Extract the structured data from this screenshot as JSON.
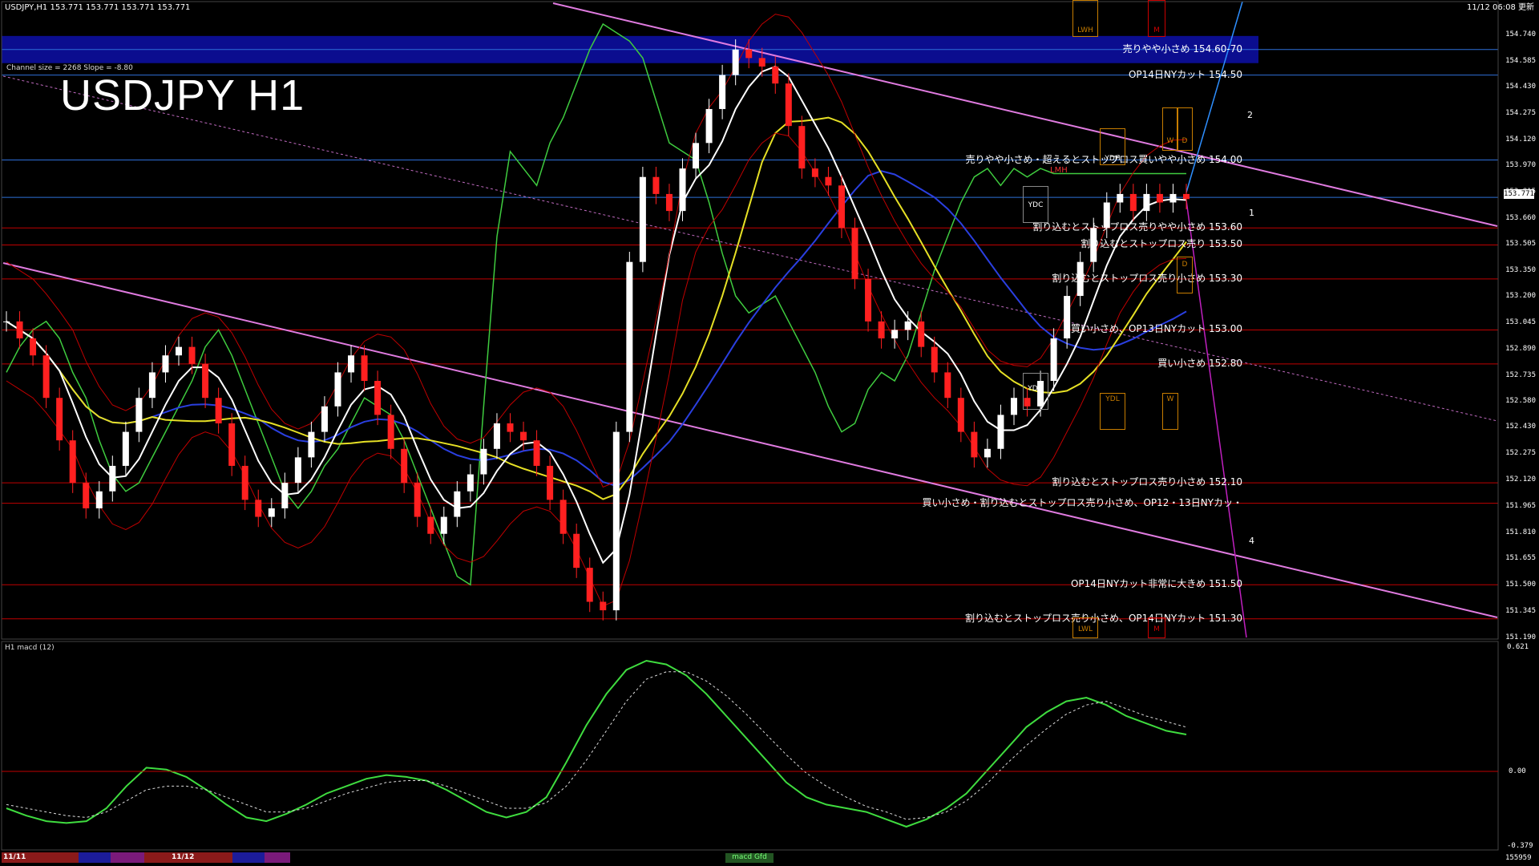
{
  "header": {
    "symbol_info": "USDJPY,H1  153.771 153.771 153.771 153.771",
    "datetime": "11/12 06:08 更新"
  },
  "chart_overlay": {
    "title": "USDJPY H1",
    "channel_info": "Channel size = 2268 Slope = -8.80",
    "current_price": "153.771",
    "channel_numbers": [
      "2",
      "1",
      "4"
    ]
  },
  "box_labels": {
    "lwh": "LWH",
    "m": "M",
    "ydh": "YDH",
    "w": "W",
    "d": "D",
    "lmh": "LMH",
    "ydc": "YDC",
    "ydo": "YDO",
    "ydl": "YDL",
    "w2": "W",
    "d2": "D",
    "lwl": "LWL",
    "lml": "LML"
  },
  "annotations": [
    {
      "text": "売りやや小さめ 154.60-70",
      "price": 154.65,
      "color": "#ffffff",
      "highlight": "#0b0d8f"
    },
    {
      "text": "OP14日NYカット 154.50",
      "price": 154.5,
      "color": "#ffffff"
    },
    {
      "text": "売りやや小さめ・超えるとストップロス買いやや小さめ 154.00",
      "price": 154.0,
      "color": "#ffffff"
    },
    {
      "text": "割り込むとストップロス売りやや小さめ 153.60",
      "price": 153.6,
      "color": "#ffffff"
    },
    {
      "text": "割り込むとストップロス売り 153.50",
      "price": 153.5,
      "color": "#ffffff"
    },
    {
      "text": "割り込むとストップロス売り小さめ 153.30",
      "price": 153.3,
      "color": "#ffffff"
    },
    {
      "text": "買い小さめ、OP13日NYカット 153.00",
      "price": 153.0,
      "color": "#ffffff"
    },
    {
      "text": "買い小さめ 152.80",
      "price": 152.8,
      "color": "#ffffff"
    },
    {
      "text": "割り込むとストップロス売り小さめ 152.10",
      "price": 152.1,
      "color": "#ffffff"
    },
    {
      "text": "買い小さめ・割り込むとストップロス売り小さめ、OP12・13日NYカッ・",
      "price": 151.98,
      "color": "#ffffff"
    },
    {
      "text": "OP14日NYカット非常に大きめ 151.50",
      "price": 151.5,
      "color": "#ffffff"
    },
    {
      "text": "割り込むとストップロス売り小さめ、OP14日NYカット 151.30",
      "price": 151.3,
      "color": "#ffffff"
    }
  ],
  "price_axis": {
    "ticks": [
      "154.740",
      "154.585",
      "154.430",
      "154.275",
      "154.120",
      "153.970",
      "153.815",
      "153.660",
      "153.505",
      "153.350",
      "153.200",
      "153.045",
      "152.890",
      "152.735",
      "152.580",
      "152.430",
      "152.275",
      "152.120",
      "151.965",
      "151.810",
      "151.655",
      "151.500",
      "151.345",
      "151.190"
    ]
  },
  "macd_panel": {
    "label": "H1  macd (12)",
    "axis_ticks": [
      "0.621",
      "0.00",
      "-0.379"
    ],
    "bottom_right": "155959"
  },
  "time_axis": {
    "labels": [
      "11/11",
      "11/12"
    ],
    "indicator_tab": "macd Gfd"
  },
  "chart_data": {
    "type": "candlestick",
    "symbol": "USDJPY",
    "timeframe": "H1",
    "ylim": [
      151.19,
      154.8
    ],
    "horizontal_levels": [
      154.65,
      154.5,
      154.0,
      153.6,
      153.5,
      153.3,
      153.0,
      152.8,
      152.1,
      151.98,
      151.5,
      151.3
    ],
    "close_prices": [
      153.05,
      152.95,
      152.85,
      152.6,
      152.35,
      152.1,
      151.95,
      152.05,
      152.2,
      152.4,
      152.6,
      152.75,
      152.85,
      152.9,
      152.8,
      152.6,
      152.45,
      152.2,
      152.0,
      151.9,
      151.95,
      152.1,
      152.25,
      152.4,
      152.55,
      152.75,
      152.85,
      152.7,
      152.5,
      152.3,
      152.1,
      151.9,
      151.8,
      151.9,
      152.05,
      152.15,
      152.3,
      152.45,
      152.4,
      152.35,
      152.2,
      152.0,
      151.8,
      151.6,
      151.4,
      151.35,
      152.4,
      153.4,
      153.9,
      153.8,
      153.7,
      153.95,
      154.1,
      154.3,
      154.5,
      154.65,
      154.6,
      154.55,
      154.45,
      154.2,
      153.95,
      153.9,
      153.85,
      153.6,
      153.3,
      153.05,
      152.95,
      153.0,
      153.05,
      152.9,
      152.75,
      152.6,
      152.4,
      152.25,
      152.3,
      152.5,
      152.6,
      152.55,
      152.7,
      152.95,
      153.2,
      153.4,
      153.6,
      153.75,
      153.8,
      153.7,
      153.8,
      153.75,
      153.8,
      153.77
    ],
    "macd": [
      -0.2,
      -0.24,
      -0.27,
      -0.28,
      -0.27,
      -0.2,
      -0.08,
      0.02,
      0.01,
      -0.03,
      -0.1,
      -0.18,
      -0.25,
      -0.27,
      -0.23,
      -0.18,
      -0.12,
      -0.08,
      -0.04,
      -0.02,
      -0.03,
      -0.05,
      -0.1,
      -0.16,
      -0.22,
      -0.25,
      -0.22,
      -0.14,
      0.05,
      0.25,
      0.42,
      0.55,
      0.6,
      0.58,
      0.52,
      0.42,
      0.3,
      0.18,
      0.06,
      -0.06,
      -0.14,
      -0.18,
      -0.2,
      -0.22,
      -0.26,
      -0.3,
      -0.26,
      -0.2,
      -0.12,
      0.0,
      0.12,
      0.24,
      0.32,
      0.38,
      0.4,
      0.36,
      0.3,
      0.26,
      0.22,
      0.2
    ],
    "signal": [
      -0.18,
      -0.2,
      -0.22,
      -0.24,
      -0.25,
      -0.22,
      -0.16,
      -0.1,
      -0.08,
      -0.08,
      -0.1,
      -0.14,
      -0.18,
      -0.22,
      -0.22,
      -0.2,
      -0.16,
      -0.12,
      -0.09,
      -0.06,
      -0.05,
      -0.05,
      -0.08,
      -0.12,
      -0.16,
      -0.2,
      -0.2,
      -0.17,
      -0.08,
      0.06,
      0.22,
      0.38,
      0.5,
      0.54,
      0.54,
      0.49,
      0.41,
      0.31,
      0.2,
      0.09,
      -0.01,
      -0.08,
      -0.14,
      -0.19,
      -0.22,
      -0.26,
      -0.25,
      -0.22,
      -0.16,
      -0.07,
      0.04,
      0.14,
      0.23,
      0.31,
      0.36,
      0.38,
      0.34,
      0.3,
      0.27,
      0.24
    ]
  }
}
